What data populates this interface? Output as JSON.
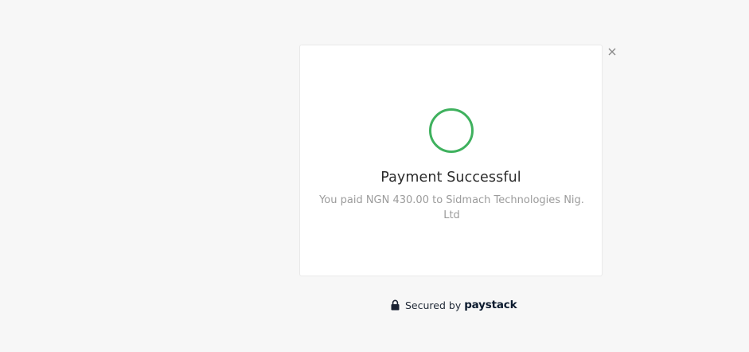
{
  "dialog": {
    "title": "Payment Successful",
    "message": "You paid NGN 430.00 to Sidmach Technologies Nig. Ltd",
    "status_color": "#3fb15e"
  },
  "close": {
    "icon": "close-icon",
    "label": "×"
  },
  "footer": {
    "secured_label": "Secured by",
    "brand": "paystack",
    "icon": "lock-icon"
  }
}
